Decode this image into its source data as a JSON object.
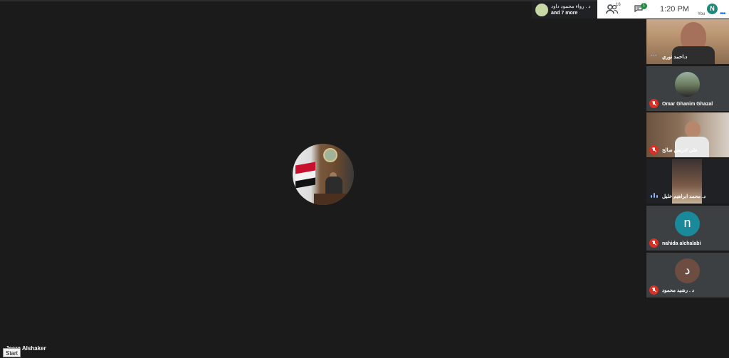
{
  "presenter": {
    "name": "د . رواء محمود داود",
    "more": "and 7 more"
  },
  "toolbar": {
    "people_count": "16",
    "chat_badge": "1",
    "time": "1:20  PM",
    "you_label": "You",
    "you_initial": "N",
    "more_icon": "more-dots-icon"
  },
  "center": {
    "name": "Jasra Alshaker"
  },
  "start_button": "Start",
  "participants": [
    {
      "name": "د.احمد نوري",
      "state": "video",
      "audio": "speaking-dots"
    },
    {
      "name": "Omar Ghanim Ghazal",
      "state": "photo",
      "audio": "muted"
    },
    {
      "name": "علي ادريس صالح",
      "state": "video",
      "audio": "muted"
    },
    {
      "name": "د. محمد ابراهيم خليل",
      "state": "video",
      "audio": "speaking-bars"
    },
    {
      "name": "nahida alchalabi",
      "state": "initial",
      "initial": "n",
      "color": "#1a8a9a",
      "audio": "muted"
    },
    {
      "name": "د . رشيد محمود",
      "state": "initial",
      "initial": "د",
      "color": "#6d4c41",
      "audio": "muted"
    }
  ]
}
